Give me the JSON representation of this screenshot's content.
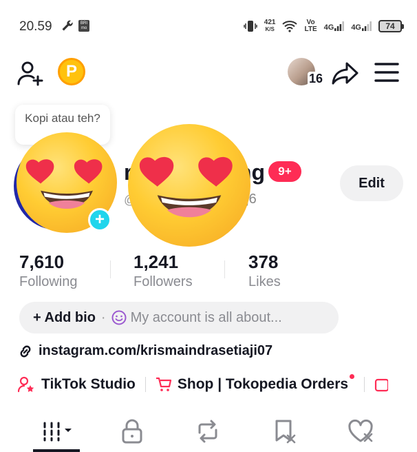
{
  "status_bar": {
    "time": "20.59",
    "bri_label": "BRI mo",
    "net_speed_value": "421",
    "net_speed_unit": "K/S",
    "volte_top": "Vo",
    "volte_bottom": "LTE",
    "network_1": "4G",
    "network_2": "4G",
    "battery": "74"
  },
  "top_bar": {
    "coin_label": "P",
    "friends_count": "16"
  },
  "note": {
    "text": "Kopi atau teh?"
  },
  "profile": {
    "name_start": "r",
    "name_end": "ng",
    "handle_start": "@",
    "handle_end": "aj6",
    "notifications_badge": "9+",
    "edit_label": "Edit"
  },
  "stats": [
    {
      "value": "7,610",
      "label": "Following"
    },
    {
      "value": "1,241",
      "label": "Followers"
    },
    {
      "value": "378",
      "label": "Likes"
    }
  ],
  "bio": {
    "add_label": "+ Add bio",
    "separator": "·",
    "placeholder": "My account is all about..."
  },
  "link": {
    "url": "instagram.com/krismaindrasetiaji07"
  },
  "tools": {
    "studio_label": "TikTok Studio",
    "shop_label": "Shop | Tokopedia Orders"
  },
  "colors": {
    "accent_red": "#fe2c55",
    "accent_cyan": "#20d5ec",
    "coin_gold": "#ffc20e",
    "text_primary": "#161823",
    "text_secondary": "#8a8b91"
  }
}
